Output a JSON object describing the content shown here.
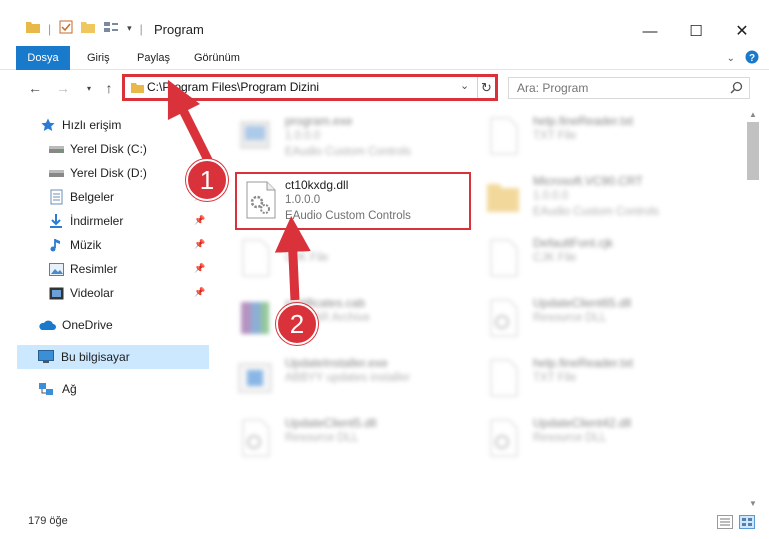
{
  "window": {
    "title": "Program",
    "minimize": "—",
    "maximize": "☐",
    "close": "✕"
  },
  "ribbon": {
    "tabs": [
      "Dosya",
      "Giriş",
      "Paylaş",
      "Görünüm"
    ]
  },
  "address": {
    "path": "C:\\Program Files\\Program Dizini",
    "search_placeholder": "Ara: Program"
  },
  "sidebar": {
    "items": [
      {
        "label": "Hızlı erişim",
        "icon": "star-icon",
        "pinned": false
      },
      {
        "label": "Yerel Disk (C:)",
        "icon": "drive-icon",
        "pinned": false
      },
      {
        "label": "Yerel Disk (D:)",
        "icon": "drive-icon",
        "pinned": false
      },
      {
        "label": "Belgeler",
        "icon": "documents-icon",
        "pinned": true
      },
      {
        "label": "İndirmeler",
        "icon": "download-icon",
        "pinned": true
      },
      {
        "label": "Müzik",
        "icon": "music-icon",
        "pinned": true
      },
      {
        "label": "Resimler",
        "icon": "pictures-icon",
        "pinned": true
      },
      {
        "label": "Videolar",
        "icon": "videos-icon",
        "pinned": true
      },
      {
        "label": "OneDrive",
        "icon": "cloud-icon",
        "pinned": false
      },
      {
        "label": "Bu bilgisayar",
        "icon": "computer-icon",
        "pinned": false
      },
      {
        "label": "Ağ",
        "icon": "network-icon",
        "pinned": false
      }
    ]
  },
  "files": {
    "highlighted": {
      "name": "ct10kxdg.dll",
      "line2": "1.0.0.0",
      "line3": "EAudio Custom Controls"
    },
    "left": [
      {
        "name": "program.exe",
        "line2": "1.0.0.0",
        "line3": "EAudio Custom Controls"
      },
      {
        "name": "cjk",
        "line2": "CJK File",
        "line3": ""
      },
      {
        "name": "certificates.cab",
        "line2": "WinRAR Archive",
        "line3": ""
      },
      {
        "name": "UpdateInstaller.exe",
        "line2": "ABBYY updates installer",
        "line3": ""
      },
      {
        "name": "UpdateClient5.dll",
        "line2": "Resource DLL",
        "line3": ""
      }
    ],
    "right": [
      {
        "name": "help.fineReader.txt",
        "line2": "TXT File",
        "line3": ""
      },
      {
        "name": "Microsoft.VC90.CRT",
        "line2": "1.0.0.0",
        "line3": "EAudio Custom Controls"
      },
      {
        "name": "DefaultFont.cjk",
        "line2": "CJK File",
        "line3": ""
      },
      {
        "name": "UpdateClient65.dll",
        "line2": "Resource DLL",
        "line3": ""
      },
      {
        "name": "help.fineReader.txt",
        "line2": "TXT File",
        "line3": ""
      },
      {
        "name": "UpdateClient42.dll",
        "line2": "Resource DLL",
        "line3": ""
      }
    ]
  },
  "status": {
    "count": "179 öğe"
  },
  "annotations": {
    "step1": "1",
    "step2": "2"
  },
  "colors": {
    "accent": "#1979ca",
    "highlight_red": "#d9323b",
    "selected_bg": "#cce8ff"
  }
}
